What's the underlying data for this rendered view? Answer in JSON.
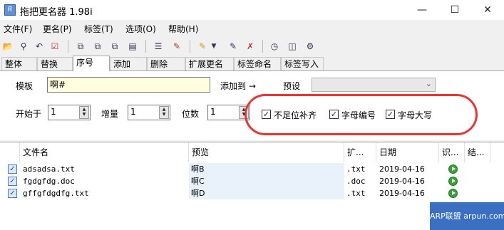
{
  "window": {
    "title": "拖把更名器 1.98i",
    "app_icon": "R"
  },
  "menu": [
    "文件(F)",
    "更名(P)",
    "标签(T)",
    "选项(O)",
    "帮助(H)"
  ],
  "tabs": [
    "整体",
    "替换",
    "序号",
    "添加",
    "删除",
    "扩展更名",
    "标签命名",
    "标签写入"
  ],
  "active_tab": "序号",
  "form": {
    "template_label": "模板",
    "template_value": "啊#",
    "add_to_label": "添加到 →",
    "preset_label": "预设",
    "preset_value": "",
    "start_label": "开始于",
    "start_value": "1",
    "step_label": "增量",
    "step_value": "1",
    "digits_label": "位数",
    "digits_value": "1",
    "pad_label": "不足位补齐",
    "pad_checked": true,
    "letter_numbering_label": "字母编号",
    "letter_numbering_checked": true,
    "uppercase_label": "字母大写",
    "uppercase_checked": true
  },
  "list": {
    "columns": [
      "文件名",
      "预览",
      "扩...",
      "日期",
      "识...",
      "结..."
    ],
    "rows": [
      {
        "name": "adsadsa.txt",
        "preview": "啊B",
        "ext": ".txt",
        "date": "2019-04-16",
        "checked": true
      },
      {
        "name": "fgdgfdg.doc",
        "preview": "啊C",
        "ext": ".doc",
        "date": "2019-04-16",
        "checked": true
      },
      {
        "name": "gffgfdgdfg.txt",
        "preview": "啊D",
        "ext": ".txt",
        "date": "2019-04-16",
        "checked": true
      }
    ]
  },
  "watermark": "ARP联盟 arpun.com",
  "icons": {
    "titlebar": [
      "app-icon",
      "minimize-icon",
      "maximize-icon",
      "close-icon"
    ],
    "toolbar": [
      "open-folder-icon",
      "search-icon",
      "undo-icon",
      "check-icon",
      "copy-icon",
      "paste-icon",
      "cut-icon",
      "document-icon",
      "list-icon",
      "edit-icon",
      "pen-icon",
      "dropdown-arrow-icon",
      "rename-icon",
      "rename-x-icon",
      "clock-icon",
      "window-icon",
      "tools-icon"
    ]
  },
  "colors": {
    "template_bg": "#ffffe0",
    "annotation": "#e83535",
    "status_green": "#36a335",
    "watermark_bg": "#3a6fc2"
  }
}
